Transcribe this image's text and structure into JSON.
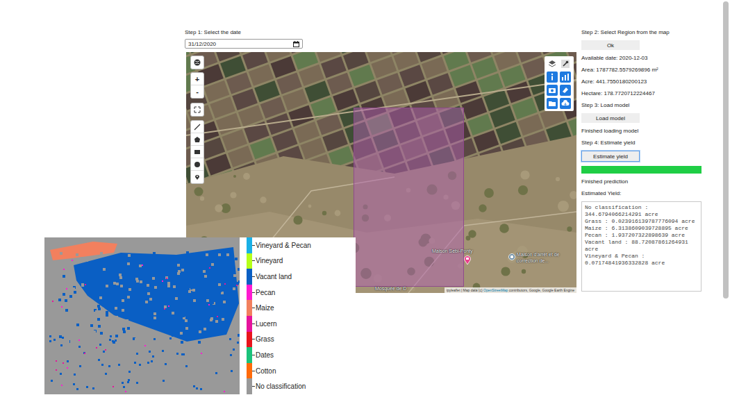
{
  "step1": {
    "label": "Step 1: Select the date",
    "date": "31/12/2020"
  },
  "map": {
    "zoom_in": "+",
    "zoom_out": "-",
    "places": [
      {
        "label": "Maison Sebi-Ponty"
      },
      {
        "label": "Maison d'arrêt et de correction de..."
      }
    ],
    "cut_label": "Mosquée de D",
    "attribution_prefix": "ipyleaflet | Map data (c) ",
    "attribution_link": "OpenStreetMap",
    "attribution_suffix": " contributors, Google, Google Earth Engine"
  },
  "panel": {
    "step2": "Step 2: Select Region from the map",
    "ok_button": "Ok",
    "available_date": "Available date: 2020-12-03",
    "area": "Area: 1787782.5579269896 m²",
    "acre": "Acre: 441.7550180200123",
    "hectare": "Hectare: 178.7720712224467",
    "step3": "Step 3: Load model",
    "load_button": "Load model",
    "load_status": "Finished loading model",
    "step4": "Step 4: Estimate yield",
    "estimate_button": {
      "label": "Estimate yield",
      "focused": true
    },
    "progress": {
      "level": 1
    },
    "prediction_status": "Finished prediction",
    "yield_label": "Estimated Yield:",
    "yield_lines": [
      "No classification : 344.6794066214291 acre",
      "Grass : 0.023916139787776094 acre",
      "Maize : 6.3138609039728895 acre",
      "Pecan : 1.937207322898639 acre",
      "Vacant land : 88.72087861264931 acre",
      "Vineyard & Pecan : 0.07174841936332828 acre"
    ]
  },
  "legend": [
    {
      "label": "Vineyard & Pecan",
      "color": "#19b0e6"
    },
    {
      "label": "Vineyard",
      "color": "#b5ff1a"
    },
    {
      "label": "Vacant land",
      "color": "#0a5fc4"
    },
    {
      "label": "Pecan",
      "color": "#ff1ad1"
    },
    {
      "label": "Maize",
      "color": "#f2805e"
    },
    {
      "label": "Lucern",
      "color": "#e6139c"
    },
    {
      "label": "Grass",
      "color": "#e8141c"
    },
    {
      "label": "Dates",
      "color": "#1ac27a"
    },
    {
      "label": "Cotton",
      "color": "#ff6a0a"
    },
    {
      "label": "No classification",
      "color": "#999999"
    }
  ]
}
